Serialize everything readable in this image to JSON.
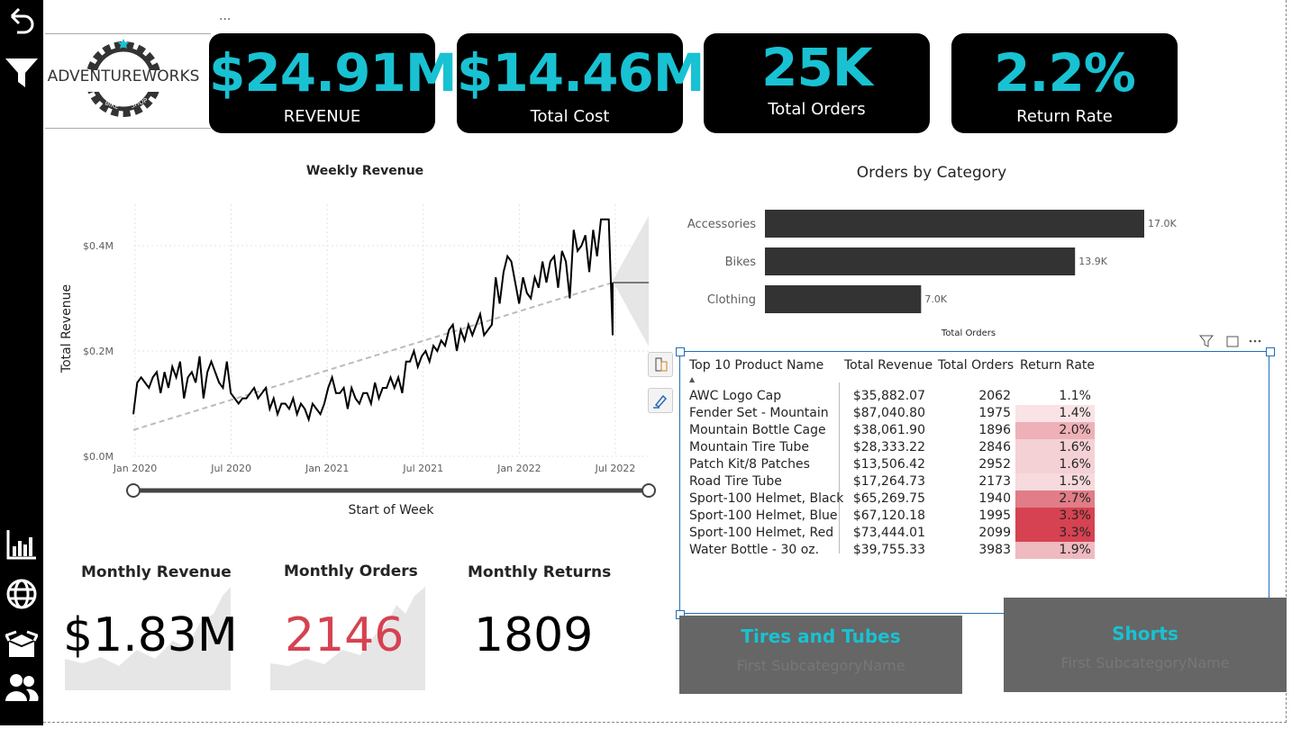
{
  "nav": {
    "icons": [
      "back-arrow-icon",
      "filter-icon",
      "bar-chart-icon",
      "globe-icon",
      "box-icon",
      "people-icon"
    ]
  },
  "visual_menu": "...",
  "logo": {
    "brand": "ADVENTUREWORKS",
    "sub1": "BIKE",
    "sub2": "SHOP"
  },
  "kpis": [
    {
      "value": "$24.91M",
      "label": "REVENUE"
    },
    {
      "value": "$14.46M",
      "label": "Total Cost"
    },
    {
      "value": "25K",
      "label": "Total Orders"
    },
    {
      "value": "2.2%",
      "label": "Return Rate"
    }
  ],
  "weekly": {
    "title": "Weekly Revenue",
    "xlabel": "Start of Week",
    "ylabel": "Total Revenue",
    "yticks": [
      "$0.4M",
      "$0.2M",
      "$0.0M"
    ],
    "xticks": [
      "Jan 2020",
      "Jul 2020",
      "Jan 2021",
      "Jul 2021",
      "Jan 2022",
      "Jul 2022"
    ]
  },
  "chart_data": [
    {
      "type": "line",
      "title": "Weekly Revenue",
      "xlabel": "Start of Week",
      "ylabel": "Total Revenue",
      "ylim": [
        0,
        0.45
      ],
      "x_range": [
        "2020-01",
        "2022-07"
      ],
      "y_unit": "$M",
      "series": [
        {
          "name": "",
          "values": [
            0.08,
            0.14,
            0.15,
            0.14,
            0.13,
            0.15,
            0.16,
            0.12,
            0.16,
            0.13,
            0.17,
            0.15,
            0.18,
            0.11,
            0.15,
            0.16,
            0.14,
            0.19,
            0.11,
            0.16,
            0.18,
            0.16,
            0.14,
            0.13,
            0.18,
            0.12,
            0.11,
            0.1,
            0.11,
            0.11,
            0.12,
            0.13,
            0.11,
            0.12,
            0.13,
            0.09,
            0.11,
            0.08,
            0.1,
            0.1,
            0.09,
            0.11,
            0.08,
            0.1,
            0.09,
            0.07,
            0.1,
            0.09,
            0.08,
            0.1,
            0.13,
            0.15,
            0.12,
            0.12,
            0.13,
            0.09,
            0.13,
            0.11,
            0.1,
            0.12,
            0.12,
            0.1,
            0.14,
            0.11,
            0.13,
            0.13,
            0.15,
            0.13,
            0.15,
            0.12,
            0.18,
            0.18,
            0.2,
            0.17,
            0.19,
            0.2,
            0.18,
            0.21,
            0.2,
            0.22,
            0.21,
            0.24,
            0.25,
            0.2,
            0.24,
            0.22,
            0.25,
            0.23,
            0.25,
            0.27,
            0.23,
            0.24,
            0.25,
            0.34,
            0.29,
            0.35,
            0.38,
            0.37,
            0.33,
            0.29,
            0.34,
            0.31,
            0.3,
            0.34,
            0.32,
            0.37,
            0.33,
            0.37,
            0.38,
            0.32,
            0.39,
            0.37,
            0.3,
            0.43,
            0.39,
            0.4,
            0.42,
            0.35,
            0.43,
            0.38,
            0.45,
            0.45,
            0.45,
            0.23,
            0.33,
            0.33,
            0.33
          ]
        },
        {
          "name": "",
          "values": [
            0.05,
            0.33
          ]
        }
      ]
    },
    {
      "type": "bar",
      "title": "Orders by Category",
      "xlabel": "Total Orders",
      "categories": [
        "Accessories",
        "Bikes",
        "Clothing"
      ],
      "values": [
        17000,
        13900,
        7000
      ],
      "labels": [
        "17.0K",
        "13.9K",
        "7.0K"
      ]
    },
    {
      "type": "table",
      "columns": [
        "Top 10 Product Name",
        "Total Revenue",
        "Total Orders",
        "Return Rate"
      ],
      "rows": [
        [
          "AWC Logo Cap",
          "$35,882.07",
          "2062",
          "1.1%"
        ],
        [
          "Fender Set - Mountain",
          "$87,040.80",
          "1975",
          "1.4%"
        ],
        [
          "Mountain Bottle Cage",
          "$38,061.90",
          "1896",
          "2.0%"
        ],
        [
          "Mountain Tire Tube",
          "$28,333.22",
          "2846",
          "1.6%"
        ],
        [
          "Patch Kit/8 Patches",
          "$13,506.42",
          "2952",
          "1.6%"
        ],
        [
          "Road Tire Tube",
          "$17,264.73",
          "2173",
          "1.5%"
        ],
        [
          "Sport-100 Helmet, Black",
          "$65,269.75",
          "1940",
          "2.7%"
        ],
        [
          "Sport-100 Helmet, Blue",
          "$67,120.18",
          "1995",
          "3.3%"
        ],
        [
          "Sport-100 Helmet, Red",
          "$73,444.01",
          "2099",
          "3.3%"
        ],
        [
          "Water Bottle - 30 oz.",
          "$39,755.33",
          "3983",
          "1.9%"
        ]
      ]
    }
  ],
  "category": {
    "title": "Orders by Category",
    "xlabel": "Total Orders",
    "bar_color": "#333333"
  },
  "matrix": {
    "headers": [
      "Top 10 Product Name",
      "Total Revenue",
      "Total Orders",
      "Return Rate"
    ],
    "rate_colors": [
      "#ffffff",
      "#f9e3e5",
      "#eeb1b7",
      "#f4d1d5",
      "#f4d1d5",
      "#f6dadd",
      "#e07d87",
      "#d64251",
      "#d64251",
      "#efbac0"
    ]
  },
  "monthly": [
    {
      "title": "Monthly Revenue",
      "value": "$1.83M",
      "color": "#000000"
    },
    {
      "title": "Monthly Orders",
      "value": "2146",
      "color": "#d64251"
    },
    {
      "title": "Monthly Returns",
      "value": "1809",
      "color": "#000000"
    }
  ],
  "subcards": [
    {
      "value": "Tires and Tubes",
      "label": "First SubcategoryName"
    },
    {
      "value": "Shorts",
      "label": "First SubcategoryName"
    }
  ],
  "colors": {
    "accent": "#18c2d2",
    "selection": "#1f6fb5"
  }
}
